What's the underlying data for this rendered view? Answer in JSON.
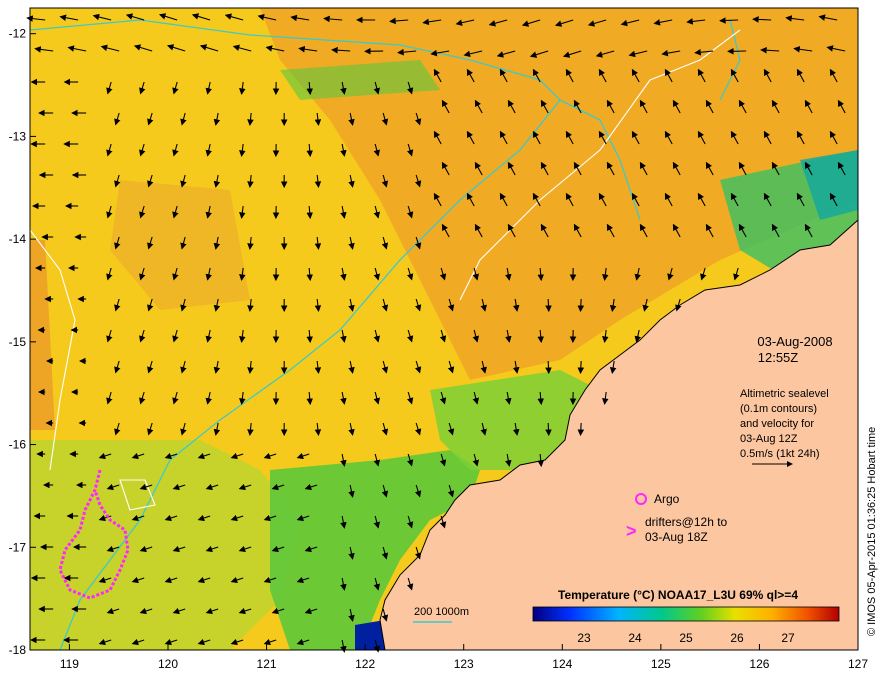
{
  "map": {
    "lon_ticks": [
      "119",
      "120",
      "121",
      "122",
      "123",
      "124",
      "125",
      "126",
      "127"
    ],
    "lat_ticks": [
      "-12",
      "-13",
      "-14",
      "-15",
      "-16",
      "-17",
      "-18"
    ],
    "extent": {
      "lon": [
        118.6,
        127
      ],
      "lat": [
        -18,
        -11.75
      ]
    }
  },
  "annotations": {
    "date": "03-Aug-2008",
    "time": "12:55Z",
    "altimetry": [
      "Altimetric sealevel",
      "(0.1m contours)",
      "and velocity for",
      "03-Aug 12Z",
      "0.5m/s (1kt 24h)"
    ],
    "argo_label": "Argo",
    "drifters": [
      "drifters@12h to",
      "03-Aug 18Z"
    ],
    "scale_bar": "200  1000m",
    "credit": "© IMOS 05-Apr-2015 01:36:25 Hobart time"
  },
  "colorbar": {
    "title": "Temperature (°C) NOAA17_L3U 69% ql>=4",
    "ticks": [
      "23",
      "24",
      "25",
      "26",
      "27"
    ],
    "range": [
      22,
      28
    ]
  },
  "colors": {
    "land": "#fcc6a0",
    "warm": "#f0a020",
    "mid": "#f6d21c",
    "cool": "#52c838",
    "contour_isobath": "#3ec9c9",
    "drifter": "#ff26ff"
  }
}
